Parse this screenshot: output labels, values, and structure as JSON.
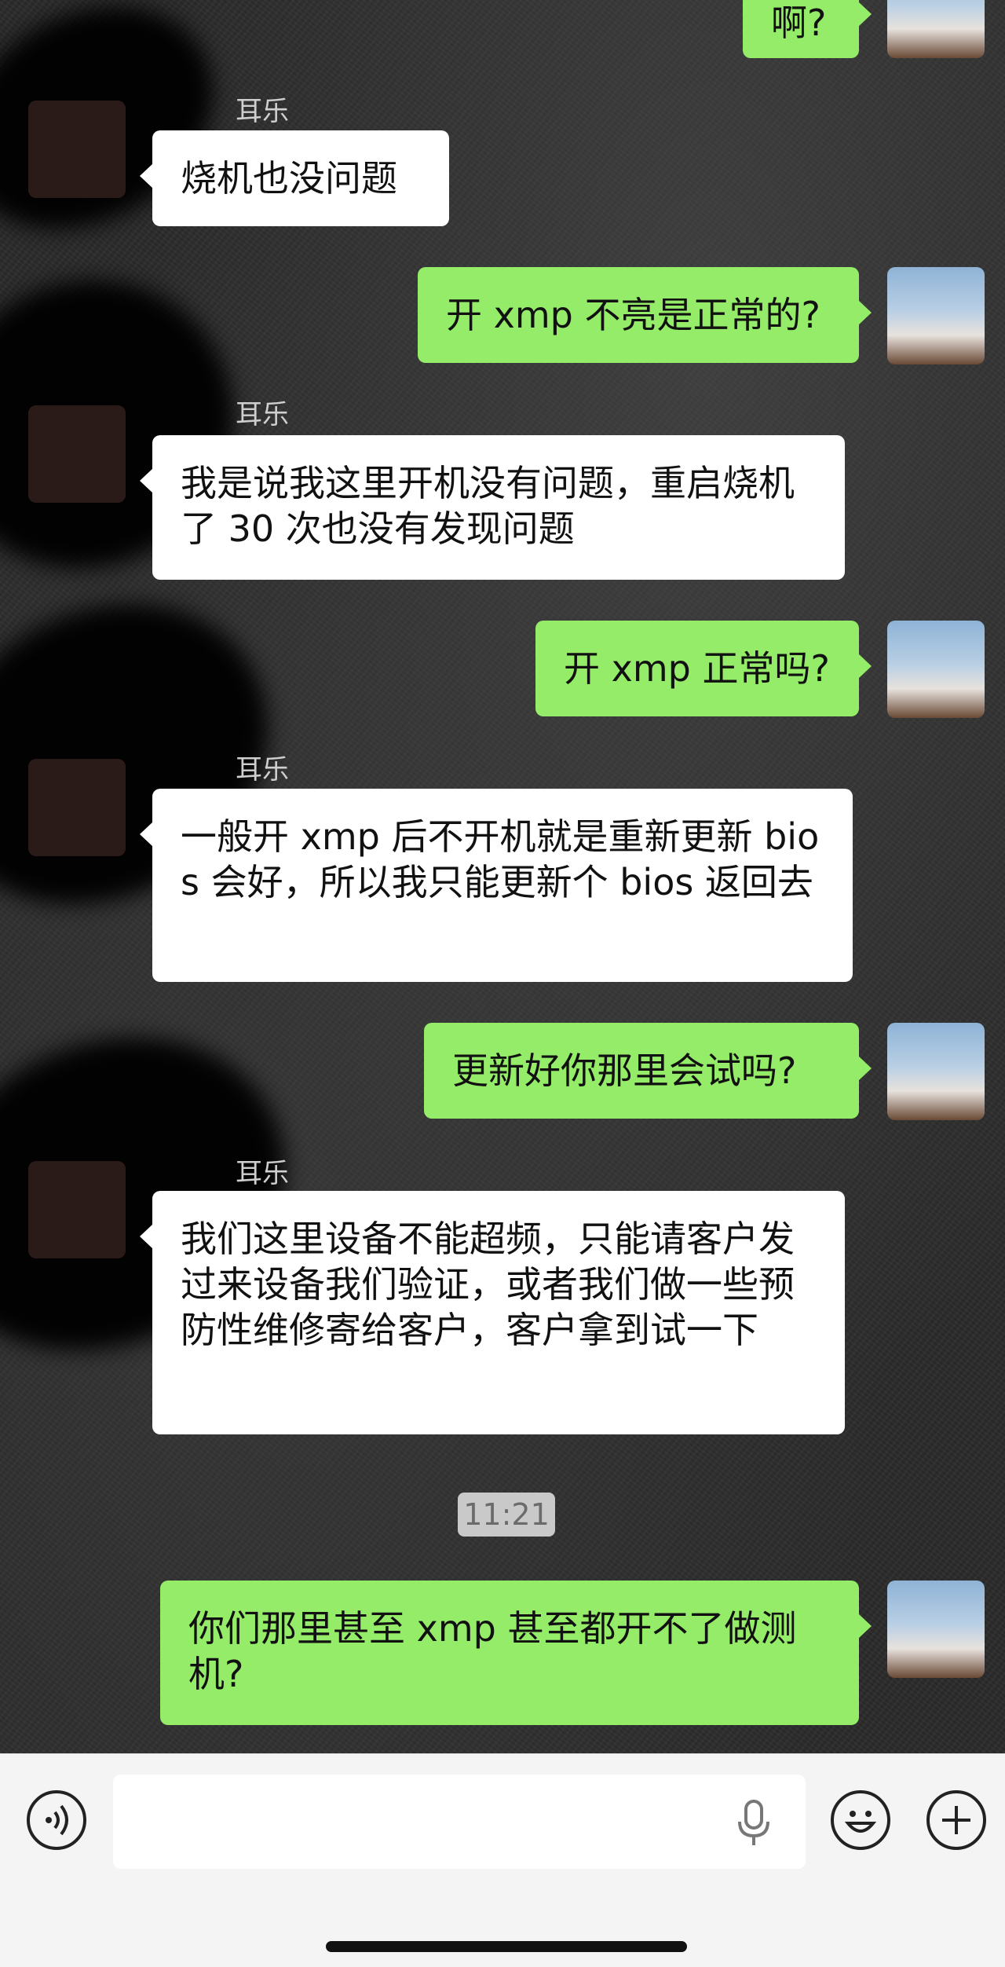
{
  "colors": {
    "outgoing_bubble": "#95ec69",
    "incoming_bubble": "#ffffff",
    "input_bar": "#f4f4f4"
  },
  "messages": [
    {
      "dir": "out",
      "text": "啊?"
    },
    {
      "dir": "in",
      "sender": "耳乐",
      "text": "烧机也没问题"
    },
    {
      "dir": "out",
      "text": "开 xmp 不亮是正常的?"
    },
    {
      "dir": "in",
      "sender": "耳乐",
      "text": "我是说我这里开机没有问题，重启烧机了 30 次也没有发现问题"
    },
    {
      "dir": "out",
      "text": "开 xmp 正常吗?"
    },
    {
      "dir": "in",
      "sender": "耳乐",
      "text": "一般开 xmp 后不开机就是重新更新 bios 会好，所以我只能更新个 bios 返回去"
    },
    {
      "dir": "out",
      "text": "更新好你那里会试吗?"
    },
    {
      "dir": "in",
      "sender": "耳乐",
      "text": "我们这里设备不能超频，只能请客户发过来设备我们验证，或者我们做一些预防性维修寄给客户，客户拿到试一下"
    },
    {
      "dir": "out",
      "text": "你们那里甚至 xmp 甚至都开不了做测机?"
    }
  ],
  "timestamp": "11:21",
  "input_bar": {
    "voice_icon": "voice-wave-icon",
    "input_value": "",
    "mic_icon": "microphone-icon",
    "emoji_icon": "smiley-icon",
    "more_icon": "plus-icon"
  }
}
